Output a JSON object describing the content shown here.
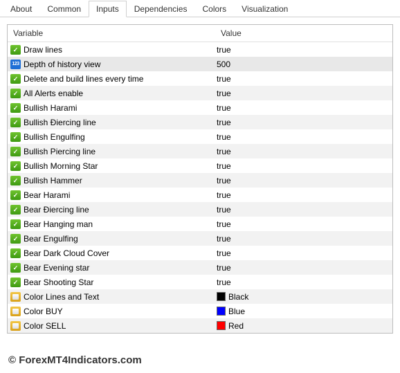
{
  "tabs": [
    "About",
    "Common",
    "Inputs",
    "Dependencies",
    "Colors",
    "Visualization"
  ],
  "active_tab": "Inputs",
  "columns": {
    "variable": "Variable",
    "value": "Value"
  },
  "rows": [
    {
      "type": "bool",
      "name": "Draw lines",
      "value": "true"
    },
    {
      "type": "int",
      "name": "Depth of history view",
      "value": "500",
      "selected": true
    },
    {
      "type": "bool",
      "name": "Delete and build lines every time",
      "value": "true"
    },
    {
      "type": "bool",
      "name": "All Alerts enable",
      "value": "true"
    },
    {
      "type": "bool",
      "name": "Bullish Harami",
      "value": "true"
    },
    {
      "type": "bool",
      "name": "Bullish Điercing line",
      "value": "true"
    },
    {
      "type": "bool",
      "name": "Bullish Engulfing",
      "value": "true"
    },
    {
      "type": "bool",
      "name": "Bullish Piercing line",
      "value": "true"
    },
    {
      "type": "bool",
      "name": "Bullish Morning Star",
      "value": "true"
    },
    {
      "type": "bool",
      "name": "Bullish Hammer",
      "value": "true"
    },
    {
      "type": "bool",
      "name": "Bear Harami",
      "value": "true"
    },
    {
      "type": "bool",
      "name": "Bear Điercing line",
      "value": "true"
    },
    {
      "type": "bool",
      "name": "Bear Hanging man",
      "value": "true"
    },
    {
      "type": "bool",
      "name": "Bear Engulfing",
      "value": "true"
    },
    {
      "type": "bool",
      "name": "Bear Dark Cloud Cover",
      "value": "true"
    },
    {
      "type": "bool",
      "name": "Bear Evening star",
      "value": "true"
    },
    {
      "type": "bool",
      "name": "Bear Shooting Star",
      "value": "true"
    },
    {
      "type": "color",
      "name": "Color Lines and Text",
      "value": "Black",
      "swatch": "#000000"
    },
    {
      "type": "color",
      "name": "Color BUY",
      "value": "Blue",
      "swatch": "#0000ff"
    },
    {
      "type": "color",
      "name": "Color SELL",
      "value": "Red",
      "swatch": "#ff0000"
    }
  ],
  "footer": "© ForexMT4Indicators.com"
}
